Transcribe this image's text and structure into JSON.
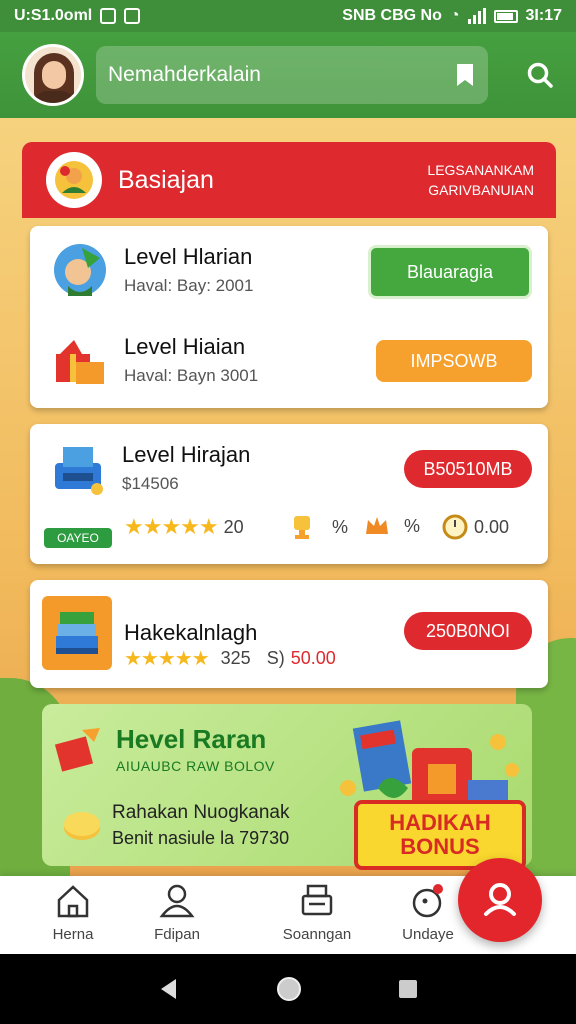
{
  "status_bar": {
    "time": "U:S1.0oml",
    "right_text": "SNB CBG No",
    "battery_text": "3I:17"
  },
  "header": {
    "search_value": "Nemahderkalain"
  },
  "section": {
    "title": "Basiajan",
    "subtitle_line1": "LEGSANANKAM",
    "subtitle_line2": "GARIVBANUIAN"
  },
  "items": [
    {
      "title": "Level Hlarian",
      "sub": "Haval: Bay: 2001",
      "button": "Blauaragia"
    },
    {
      "title": "Level Hiaian",
      "sub": "Haval: Bayn 3001",
      "button": "IMPSOWB"
    },
    {
      "title": "Level Hirajan",
      "sub": "$14506",
      "button": "B50510MB",
      "badge": "OAYEO",
      "stars": "★★★★★",
      "rating": "20",
      "stat1": "%",
      "stat2": "%",
      "stat3": "0.00"
    },
    {
      "title": "Hakekalnlagh",
      "stars": "★★★★★",
      "rating": "325",
      "price_prefix": "S)",
      "price": "50.00",
      "button": "250B0NOI"
    }
  ],
  "promo": {
    "title": "Hevel Raran",
    "subtitle": "AIUAUBC RAW BOLOV",
    "line1": "Rahakan Nuogkanak",
    "line2": "Benit nasiule la 79730",
    "bonus_line1": "HADIKAH",
    "bonus_line2": "BONUS"
  },
  "nav": [
    {
      "label": "Herna",
      "icon": "home-icon"
    },
    {
      "label": "Fdipan",
      "icon": "user-icon"
    },
    {
      "label": "Soanngan",
      "icon": "printer-icon"
    },
    {
      "label": "Undaye",
      "icon": "notification-icon"
    }
  ],
  "colors": {
    "header_green": "#45a03f",
    "accent_red": "#de2a2f",
    "button_green": "#44a83e",
    "button_orange": "#f6a02e"
  }
}
